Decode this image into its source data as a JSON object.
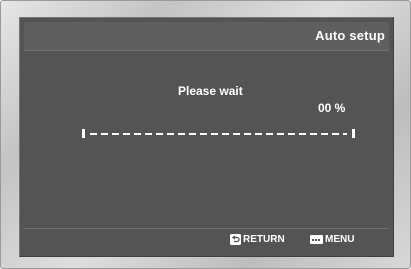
{
  "header": {
    "title": "Auto setup"
  },
  "dialog": {
    "message": "Please wait",
    "progress_text": "00 %",
    "progress_value": 0
  },
  "footer": {
    "return_label": "RETURN",
    "menu_label": "MENU",
    "return_icon": "return-arrow-icon",
    "menu_icon": "menu-icon"
  }
}
